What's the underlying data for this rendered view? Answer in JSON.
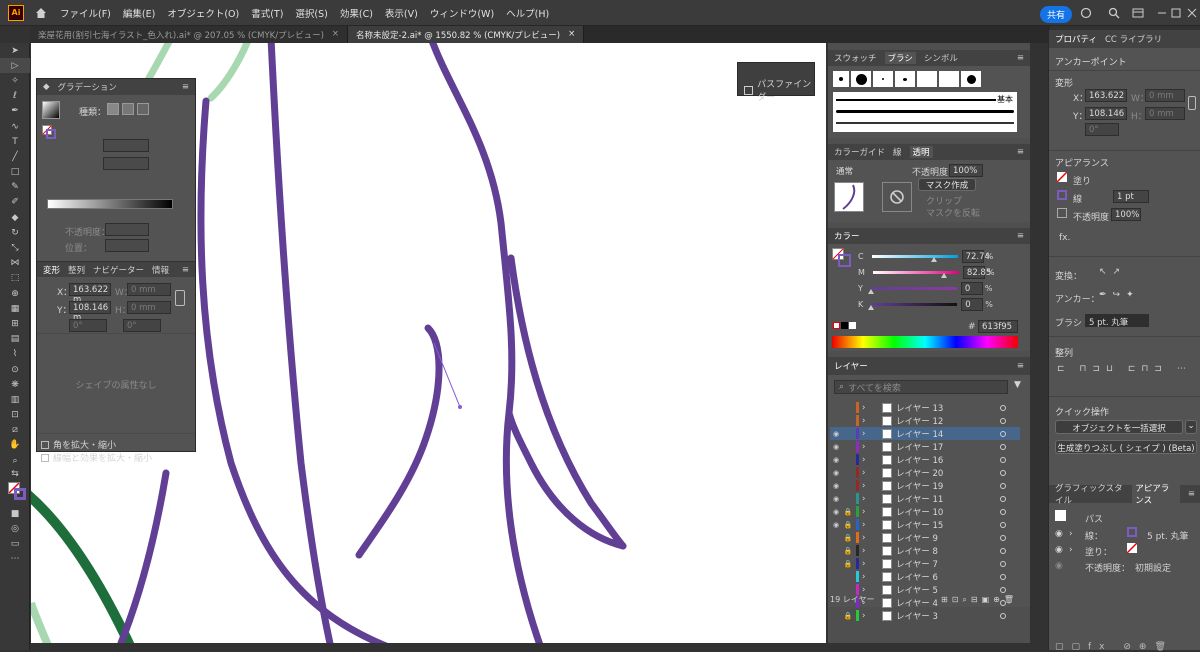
{
  "app": {
    "logo": "Ai",
    "menus": [
      "ファイル(F)",
      "編集(E)",
      "オブジェクト(O)",
      "書式(T)",
      "選択(S)",
      "効果(C)",
      "表示(V)",
      "ウィンドウ(W)",
      "ヘルプ(H)"
    ],
    "share_label": "共有"
  },
  "tabs": [
    {
      "label": "楽屋花用(割引七海イラスト_色入れ).ai* @ 207.05 % (CMYK/プレビュー)",
      "close": "×"
    },
    {
      "label": "名称未設定-2.ai* @ 1550.82 % (CMYK/プレビュー)",
      "close": "×"
    }
  ],
  "gradient_panel": {
    "title": "グラデーション",
    "type_label": "種類：",
    "opacity_label": "不透明度：",
    "position_label": "位置：",
    "transform_tabs": [
      "変形",
      "整列",
      "ナビゲーター",
      "情報"
    ],
    "x_label": "X：",
    "x_value": "163.622 m",
    "y_label": "Y：",
    "y_value": "108.146 m",
    "w_label": "W：",
    "w_value": "0 mm",
    "h_label": "H：",
    "h_value": "0 mm",
    "angle_value": "0°",
    "shear_value": "0°",
    "no_shape_text": "シェイプの属性なし",
    "checkbox_scale_corners": "角を拡大・縮小",
    "checkbox_scale_strokes": "線幅と効果を拡大・縮小"
  },
  "pathfinder": {
    "label": "パスファインダー"
  },
  "swatch_panel": {
    "tabs": [
      "スウォッチ",
      "ブラシ",
      "シンボル"
    ],
    "brush_basic_label": "基本"
  },
  "transparency_panel": {
    "tabs": [
      "カラーガイド",
      "線",
      "透明"
    ],
    "blend_mode": "通常",
    "opacity_label": "不透明度：",
    "opacity_value": "100%",
    "mask_button": "マスク作成",
    "clip_label": "クリップ",
    "invert_label": "マスクを反転"
  },
  "color_panel": {
    "title": "カラー",
    "channels": [
      {
        "label": "C",
        "value": "72.74",
        "unit": "%",
        "level": 0.73
      },
      {
        "label": "M",
        "value": "82.85",
        "unit": "%",
        "level": 0.83
      },
      {
        "label": "Y",
        "value": "0",
        "unit": "%",
        "level": 0
      },
      {
        "label": "K",
        "value": "0",
        "unit": "%",
        "level": 0
      }
    ],
    "hex_value": "613f95",
    "hex_symbol": "#"
  },
  "layers_panel": {
    "title": "レイヤー",
    "search_placeholder": "すべてを検索",
    "layers": [
      {
        "name": "レイヤー 13",
        "visible": false,
        "locked": false,
        "color": "#c86428",
        "selected": false
      },
      {
        "name": "レイヤー 12",
        "visible": false,
        "locked": false,
        "color": "#c86428",
        "selected": false
      },
      {
        "name": "レイヤー 14",
        "visible": true,
        "locked": false,
        "color": "#5a3cb4",
        "selected": true
      },
      {
        "name": "レイヤー 17",
        "visible": true,
        "locked": false,
        "color": "#9628c8",
        "selected": false
      },
      {
        "name": "レイヤー 16",
        "visible": true,
        "locked": false,
        "color": "#282896",
        "selected": false
      },
      {
        "name": "レイヤー 20",
        "visible": true,
        "locked": false,
        "color": "#962828",
        "selected": false
      },
      {
        "name": "レイヤー 19",
        "visible": true,
        "locked": false,
        "color": "#962828",
        "selected": false
      },
      {
        "name": "レイヤー 11",
        "visible": true,
        "locked": false,
        "color": "#28968c",
        "selected": false
      },
      {
        "name": "レイヤー 10",
        "visible": true,
        "locked": true,
        "color": "#28a03c",
        "selected": false
      },
      {
        "name": "レイヤー 15",
        "visible": true,
        "locked": true,
        "color": "#2864c8",
        "selected": false
      },
      {
        "name": "レイヤー 9",
        "visible": false,
        "locked": true,
        "color": "#dc6e1e",
        "selected": false
      },
      {
        "name": "レイヤー 8",
        "visible": false,
        "locked": true,
        "color": "#282828",
        "selected": false
      },
      {
        "name": "レイヤー 7",
        "visible": false,
        "locked": true,
        "color": "#282896",
        "selected": false
      },
      {
        "name": "レイヤー 6",
        "visible": false,
        "locked": false,
        "color": "#28c8dc",
        "selected": false
      },
      {
        "name": "レイヤー 5",
        "visible": false,
        "locked": false,
        "color": "#c828c8",
        "selected": false
      },
      {
        "name": "レイヤー 4",
        "visible": false,
        "locked": false,
        "color": "#8228c8",
        "selected": false
      },
      {
        "name": "レイヤー 3",
        "visible": false,
        "locked": true,
        "color": "#28c83c",
        "selected": false
      }
    ],
    "count_label": "19 レイヤー"
  },
  "properties_panel": {
    "tabs": [
      "プロパティ",
      "CC ライブラリ"
    ],
    "object_type": "アンカーポイント",
    "transform_title": "変形",
    "x_label": "X：",
    "x_value": "163.622",
    "y_label": "Y：",
    "y_value": "108.146",
    "w_label": "W：",
    "w_value": "0 mm",
    "h_label": "H：",
    "h_value": "0 mm",
    "angle_value": "0°",
    "appearance_title": "アピアランス",
    "fill_label": "塗り",
    "stroke_label": "線",
    "stroke_value": "1 pt",
    "opacity_label": "不透明度",
    "opacity_value": "100%",
    "fx_label": "fx.",
    "convert_label": "変換：",
    "anchor_label": "アンカー：",
    "brush_label": "ブラシ",
    "brush_value": "5 pt. 丸筆",
    "align_title": "整列",
    "quick_actions_title": "クイック操作",
    "select_all_button": "オブジェクトを一括選択",
    "generative_fill_button": "生成塗りつぶし ( シェイプ ) (Beta)"
  },
  "appearance_panel": {
    "tabs": [
      "グラフィックスタイル",
      "アピアランス"
    ],
    "path_label": "パス",
    "stroke_label": "線：",
    "stroke_value": "5 pt. 丸筆",
    "fill_label": "塗り：",
    "opacity_label": "不透明度：",
    "opacity_value": "初期設定"
  },
  "colors": {
    "accent": "#1473e6",
    "stroke_purple": "#613f95",
    "green_dark": "#1e6e3c",
    "green_light": "#a8d8b0",
    "selection_blue": "#46668c"
  }
}
